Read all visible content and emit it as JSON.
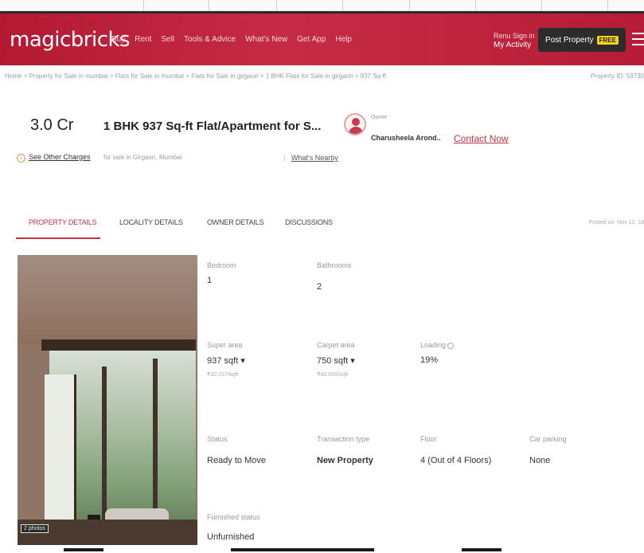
{
  "header": {
    "logo": "magicbricks",
    "nav_items": [
      "Buy",
      "Rent",
      "Sell",
      "Tools & Advice",
      "What's New",
      "Get App",
      "Help"
    ],
    "activity_top": "Renu Sign in",
    "activity_label": "My Activity",
    "post_property_label": "Post Property",
    "free_badge": "FREE"
  },
  "breadcrumb": {
    "path": "Home > Property for Sale in mumbai > Flats for Sale in mumbai > Flats for Sale in girgaon > 1 BHK Flats for Sale in girgaon > 937 Sq-ft",
    "right_text": "Property ID: 59730"
  },
  "listing": {
    "price": "3.0 Cr",
    "title": "1 BHK 937 Sq-ft Flat/Apartment for S...",
    "see_other_charges": "See Other Charges",
    "subtitle": "for sale in Girgaon, Mumbai",
    "whats_nearby": "What's Nearby",
    "owner_label": "Owner",
    "owner_name": "Charusheela Arond..",
    "contact_now": "Contact Now"
  },
  "tabs": {
    "items": [
      "PROPERTY DETAILS",
      "LOCALITY DETAILS",
      "OWNER DETAILS",
      "DISCUSSIONS"
    ],
    "posted_on": "Posted on: Nov 12, 18"
  },
  "photo": {
    "count_label": "2 photos"
  },
  "details": {
    "bedroom_label": "Bedroom",
    "bedroom_value": "1",
    "bathrooms_label": "Bathrooms",
    "bathrooms_value": "2",
    "super_area_label": "Super area",
    "super_area_value": "937 sqft ▾",
    "super_area_sub": "₹32,017/sqft",
    "carpet_area_label": "Carpet area",
    "carpet_area_value": "750 sqft ▾",
    "carpet_area_sub": "₹40,000/sqft",
    "loading_label": "Loading",
    "loading_value": "19%",
    "status_label": "Status",
    "status_value": "Ready to Move",
    "transaction_label": "Transaction type",
    "transaction_value": "New Property",
    "floor_label": "Floor",
    "floor_value": "4 (Out of 4 Floors)",
    "car_parking_label": "Car parking",
    "car_parking_value": "None",
    "furnished_label": "Furnished status",
    "furnished_value": "Unfurnished"
  }
}
